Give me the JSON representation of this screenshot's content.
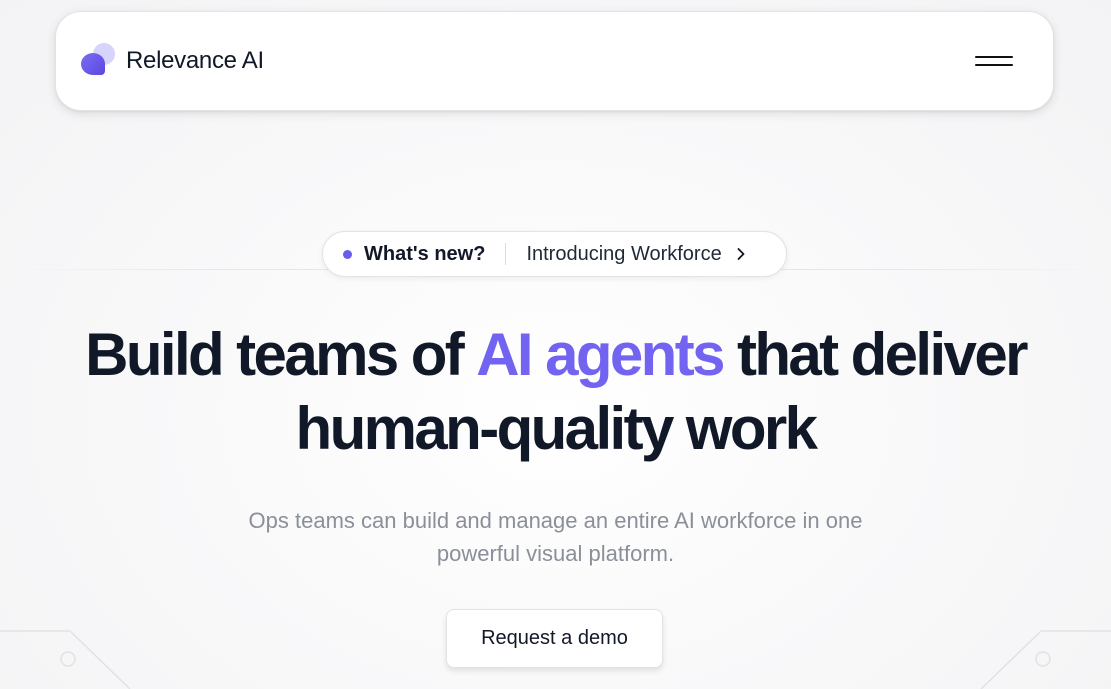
{
  "header": {
    "brand_name": "Relevance AI",
    "logo_icon": "relevance-logo-icon",
    "menu_icon": "hamburger-menu-icon"
  },
  "announcement": {
    "label": "What's new?",
    "text": "Introducing Workforce",
    "icon": "chevron-right-icon"
  },
  "hero": {
    "title_part1": "Build teams of ",
    "title_accent": "AI agents",
    "title_part2": " that deliver",
    "title_line2": "human-quality work",
    "subtitle_line1": "Ops teams can build and manage an entire AI workforce in one",
    "subtitle_line2": "powerful visual platform.",
    "cta_label": "Request a demo"
  },
  "colors": {
    "accent": "#7264f0",
    "heading": "#111827",
    "subtitle": "#8a8f99"
  }
}
